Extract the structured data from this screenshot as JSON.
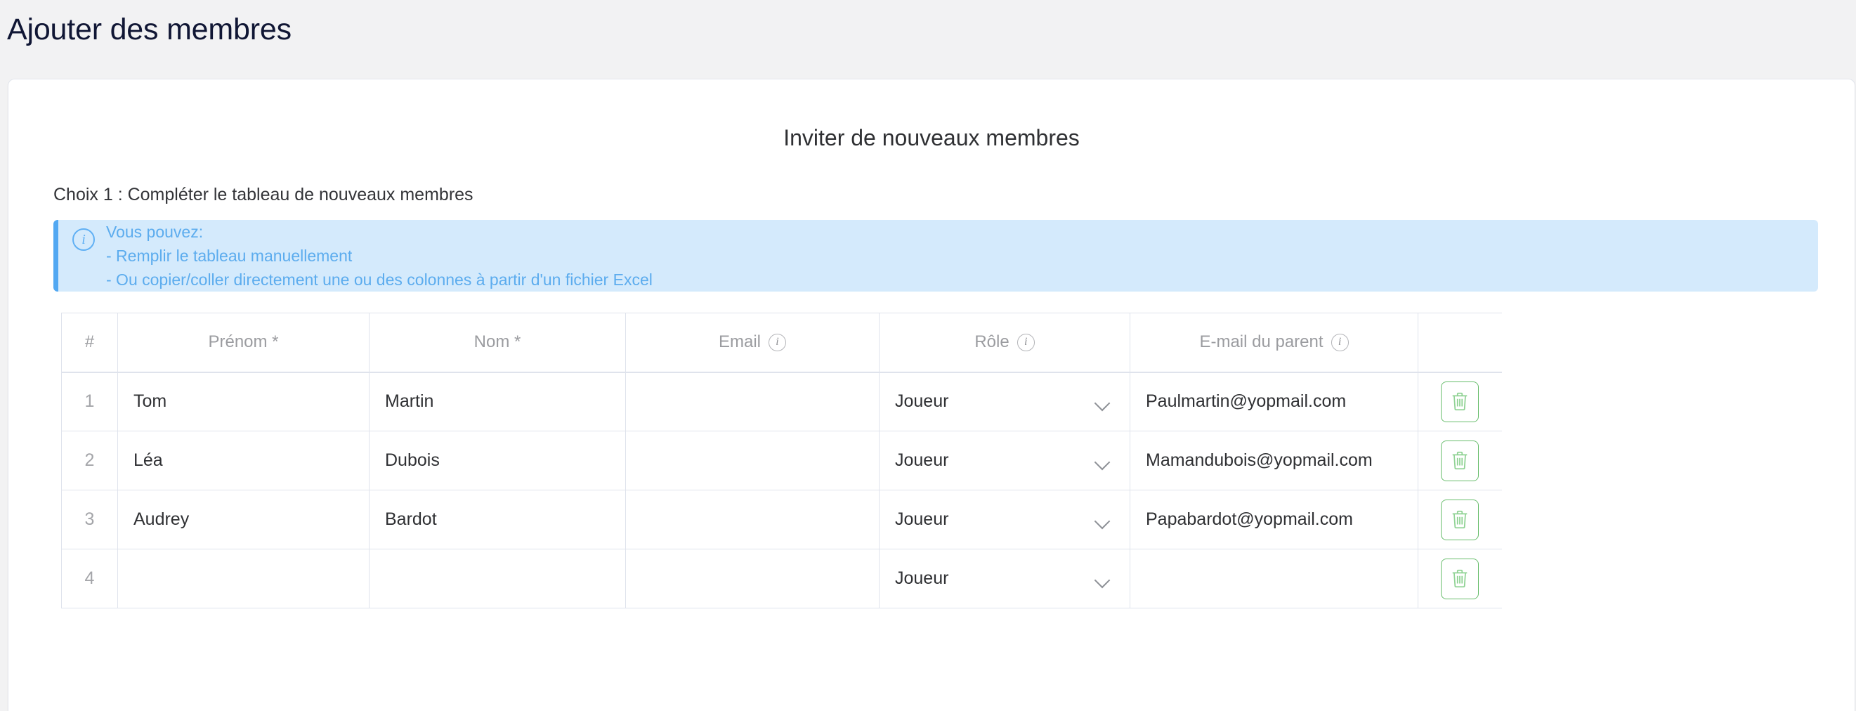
{
  "page": {
    "title": "Ajouter des membres",
    "background_color": "#f2f2f3",
    "title_color": "#101634"
  },
  "card": {
    "section_heading": "Inviter de nouveaux membres",
    "choice_label": "Choix 1 : Compléter le tableau de nouveaux membres"
  },
  "callout": {
    "icon": "info-circle-icon",
    "background_color": "#d4eafc",
    "border_color": "#52a8f2",
    "text_color": "#5cacee",
    "lines": [
      "Vous pouvez:",
      "- Remplir le tableau manuellement",
      "- Ou copier/coller directement une ou des colonnes à partir d'un fichier Excel"
    ]
  },
  "table": {
    "headers": [
      {
        "label": "#",
        "info": false
      },
      {
        "label": "Prénom *",
        "info": false
      },
      {
        "label": "Nom *",
        "info": false
      },
      {
        "label": "Email",
        "info": true
      },
      {
        "label": "Rôle",
        "info": true
      },
      {
        "label": "E-mail du parent",
        "info": true
      },
      {
        "label": "",
        "info": false
      }
    ],
    "rows": [
      {
        "index": "1",
        "first_name": "Tom",
        "last_name": "Martin",
        "email": "",
        "role": "Joueur",
        "parent_email": "Paulmartin@yopmail.com",
        "delete_label": "Supprimer"
      },
      {
        "index": "2",
        "first_name": "Léa",
        "last_name": "Dubois",
        "email": "",
        "role": "Joueur",
        "parent_email": "Mamandubois@yopmail.com",
        "delete_label": "Supprimer"
      },
      {
        "index": "3",
        "first_name": "Audrey",
        "last_name": "Bardot",
        "email": "",
        "role": "Joueur",
        "parent_email": "Papabardot@yopmail.com",
        "delete_label": "Supprimer"
      },
      {
        "index": "4",
        "first_name": "",
        "last_name": "",
        "email": "",
        "role": "Joueur",
        "parent_email": "",
        "delete_label": "Supprimer"
      }
    ],
    "delete_button_color": "#68bd6c",
    "border_color": "#dfe3ec"
  }
}
